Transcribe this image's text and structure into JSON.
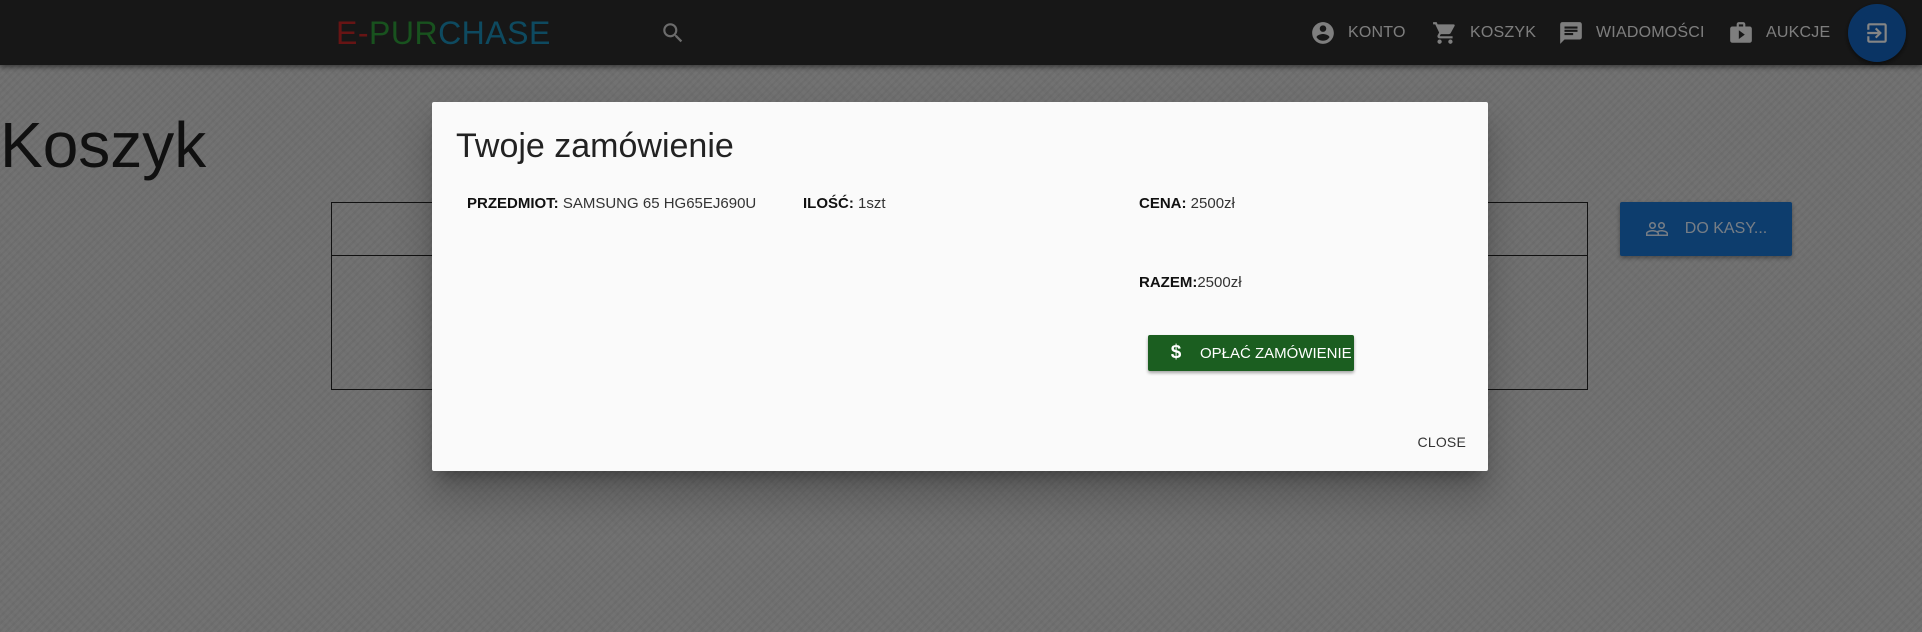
{
  "header": {
    "logo": {
      "part1": "E",
      "part2": "-",
      "part3": "PURCHASE",
      "part4": ""
    },
    "nav": {
      "konto": "KONTO",
      "koszyk": "KOSZYK",
      "wiadomosci": "WIADOMOŚCI",
      "aukcje": "AUKCJE"
    },
    "icons": {
      "search": "search-icon",
      "konto": "account-circle-icon",
      "koszyk": "cart-icon",
      "wiadomosci": "message-icon",
      "aukcje": "briefcase-icon",
      "logout": "logout-icon"
    }
  },
  "page": {
    "title": "Koszyk",
    "checkout_button": "DO KASY..."
  },
  "dialog": {
    "title": "Twoje zamówienie",
    "item_label": "PRZEDMIOT:",
    "item_value": " SAMSUNG 65 HG65EJ690U",
    "qty_label": "ILOŚĆ:",
    "qty_value": " 1szt",
    "price_label": "CENA:",
    "price_value": " 2500zł",
    "total_label": "RAZEM:",
    "total_value": "2500zł",
    "pay_button": "OPŁAĆ ZAMÓWIENIE",
    "pay_icon": "$",
    "close_button": "CLOSE"
  },
  "colors": {
    "topbar": "#2d2d2d",
    "logo_red": "#c62828",
    "logo_green": "#2e9e3b",
    "logo_blue": "#1b8fb8",
    "fab": "#1565c0",
    "checkout": "#1976d2",
    "pay": "#1b5e20"
  }
}
